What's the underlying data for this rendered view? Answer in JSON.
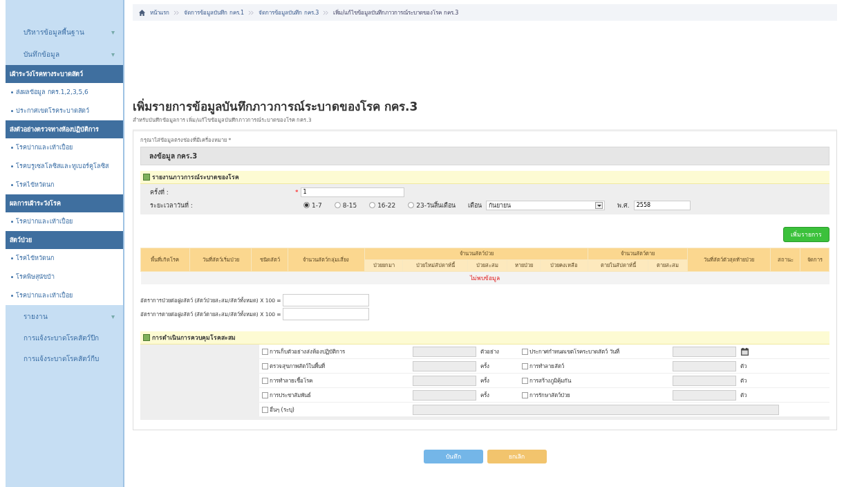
{
  "sidebar": {
    "items": [
      {
        "kind": "group",
        "label": "บริหารข้อมูลพื้นฐาน",
        "caret": "▾"
      },
      {
        "kind": "group",
        "label": "บันทึกข้อมูล",
        "caret": "▾"
      },
      {
        "kind": "header",
        "label": "เฝ้าระวังโรคทางระบาดสัตว์"
      },
      {
        "kind": "link",
        "label": "ส่งผลข้อมูล กคร.1,2,3,5,6"
      },
      {
        "kind": "link",
        "label": "ประกาศเขตโรคระบาดสัตว์"
      },
      {
        "kind": "header",
        "label": "ส่งตัวอย่างตรวจทางห้องปฏิบัติการ"
      },
      {
        "kind": "link",
        "label": "โรคปากและเท้าเปื่อย"
      },
      {
        "kind": "link",
        "label": "โรคบรูเซลโลซิสและทูเบอร์คูโลซิส"
      },
      {
        "kind": "link",
        "label": "โรคไข้หวัดนก"
      },
      {
        "kind": "header",
        "label": "ผลการเฝ้าระวังโรค"
      },
      {
        "kind": "link",
        "label": "โรคปากและเท้าเปื่อย"
      },
      {
        "kind": "header",
        "label": "สัตว์ป่วย"
      },
      {
        "kind": "link",
        "label": "โรคไข้หวัดนก"
      },
      {
        "kind": "link",
        "label": "โรคพิษสุนัขบ้า"
      },
      {
        "kind": "link",
        "label": "โรคปากและเท้าเปื่อย"
      },
      {
        "kind": "group",
        "label": "รายงาน",
        "caret": "▾"
      },
      {
        "kind": "plain",
        "label": "การแจ้งระบาดโรคสัตว์ปีก"
      },
      {
        "kind": "plain",
        "label": "การแจ้งระบาดโรคสัตว์กีบ"
      }
    ]
  },
  "breadcrumb": [
    "หน้าแรก",
    "จัดการข้อมูลบันทึก กคร.1",
    "จัดการข้อมูลบันทึก กคร.3",
    "เพิ่ม/แก้ไขข้อมูลบันทึกภาวการณ์ระบาดของโรค กคร.3"
  ],
  "title": "เพิ่มรายการข้อมูลบันทึกภาวการณ์ระบาดของโรค กคร.3",
  "subtitle": "สำหรับบันทึกข้อมูลการ เพิ่ม/แก้ไขข้อมูลบันทึกภาวการณ์ระบาดของโรค กคร.3",
  "required_note": "กรุณาใส่ข้อมูลตรงช่องที่มีเครื่องหมาย *",
  "panel_title": "ลงข้อมูล กคร.3",
  "report_section": {
    "title": "รายงานภาวการณ์ระบาดของโรค",
    "round_label": "ครั้งที่ :",
    "round_required_mark": "*",
    "round_value": "1",
    "period_label": "ระยะเวลาวันที่ :",
    "periods": [
      {
        "label": "1-7",
        "selected": true
      },
      {
        "label": "8-15",
        "selected": false
      },
      {
        "label": "16-22",
        "selected": false
      },
      {
        "label": "23-วันสิ้นเดือน",
        "selected": false
      }
    ],
    "month_label": "เดือน",
    "month_value": "กันยายน",
    "year_label": "พ.ศ.",
    "year_value": "2558"
  },
  "add_button": "เพิ่มรายการ",
  "table": {
    "columns": [
      {
        "label": "พื้นที่เกิดโรค"
      },
      {
        "label": "วันที่สัตว์เริ่มป่วย"
      },
      {
        "label": "ชนิดสัตว์"
      },
      {
        "label": "จำนวนสัตว์กลุ่มเสี่ยง"
      },
      {
        "label": "จำนวนสัตว์ป่วย",
        "children": [
          "ป่วยยกมา",
          "ป่วยใหม่สัปดาห์นี้",
          "ป่วยสะสม",
          "หายป่วย",
          "ป่วยคงเหลือ"
        ]
      },
      {
        "label": "จำนวนสัตว์ตาย",
        "children": [
          "ตายในสัปดาห์นี้",
          "ตายสะสม"
        ]
      },
      {
        "label": "วันที่สัตว์ตัวสุดท้ายป่วย"
      },
      {
        "label": "สถานะ"
      },
      {
        "label": "จัดการ"
      }
    ],
    "empty_text": "ไม่พบข้อมูล"
  },
  "rates": [
    "อัตราการป่วยต่อฝูงสัตว์ (สัตว์ป่วยสะสม/สัตว์ทั้งหมด) X 100 =",
    "อัตราการตายต่อฝูงสัตว์ (สัตว์ตายสะสม/สัตว์ทั้งหมด) X 100 ="
  ],
  "control_section": {
    "title": "การดำเนินการควบคุมโรคสะสม",
    "rows": [
      [
        {
          "label": "การเก็บตัวอย่างส่งห้องปฏิบัติการ",
          "checked": false,
          "unit": "ตัวอย่าง"
        },
        {
          "label": "ประกาศกำหนดเขตโรคระบาดสัตว์ วันที่",
          "checked": false,
          "kind": "date"
        }
      ],
      [
        {
          "label": "ตรวจสุขภาพสัตว์ในพื้นที่",
          "checked": false,
          "unit": "ครั้ง"
        },
        {
          "label": "การทำลายสัตว์",
          "checked": false,
          "unit": "ตัว"
        }
      ],
      [
        {
          "label": "การทำลายเชื้อโรค",
          "checked": false,
          "unit": "ครั้ง"
        },
        {
          "label": "การสร้างภูมิคุ้มกัน",
          "checked": false,
          "unit": "ตัว"
        }
      ],
      [
        {
          "label": "การประชาสัมพันธ์",
          "checked": false,
          "unit": "ครั้ง"
        },
        {
          "label": "การรักษาสัตว์ป่วย",
          "checked": false,
          "unit": "ตัว"
        }
      ]
    ],
    "other": {
      "label": "อื่นๆ (ระบุ)",
      "checked": false
    }
  },
  "buttons": {
    "save": "บันทึก",
    "cancel": "ยกเลิก"
  }
}
